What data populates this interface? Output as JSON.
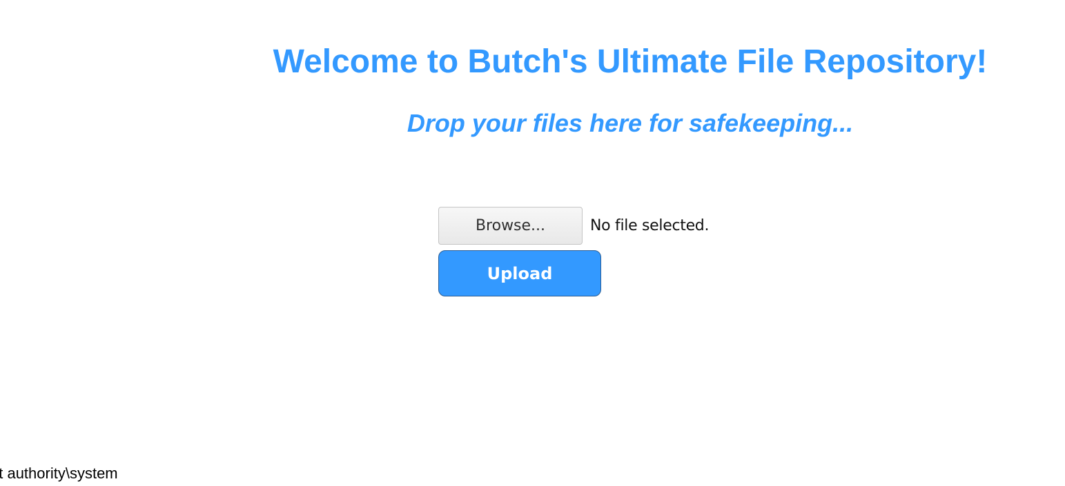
{
  "header": {
    "title": "Welcome to Butch's Ultimate File Repository!",
    "subtitle": "Drop your files here for safekeeping..."
  },
  "upload": {
    "browse_label": "Browse...",
    "file_status": "No file selected.",
    "upload_label": "Upload"
  },
  "output": {
    "text": "nt authority\\system"
  },
  "colors": {
    "accent": "#3399ff",
    "button_border": "#2a5d93"
  }
}
